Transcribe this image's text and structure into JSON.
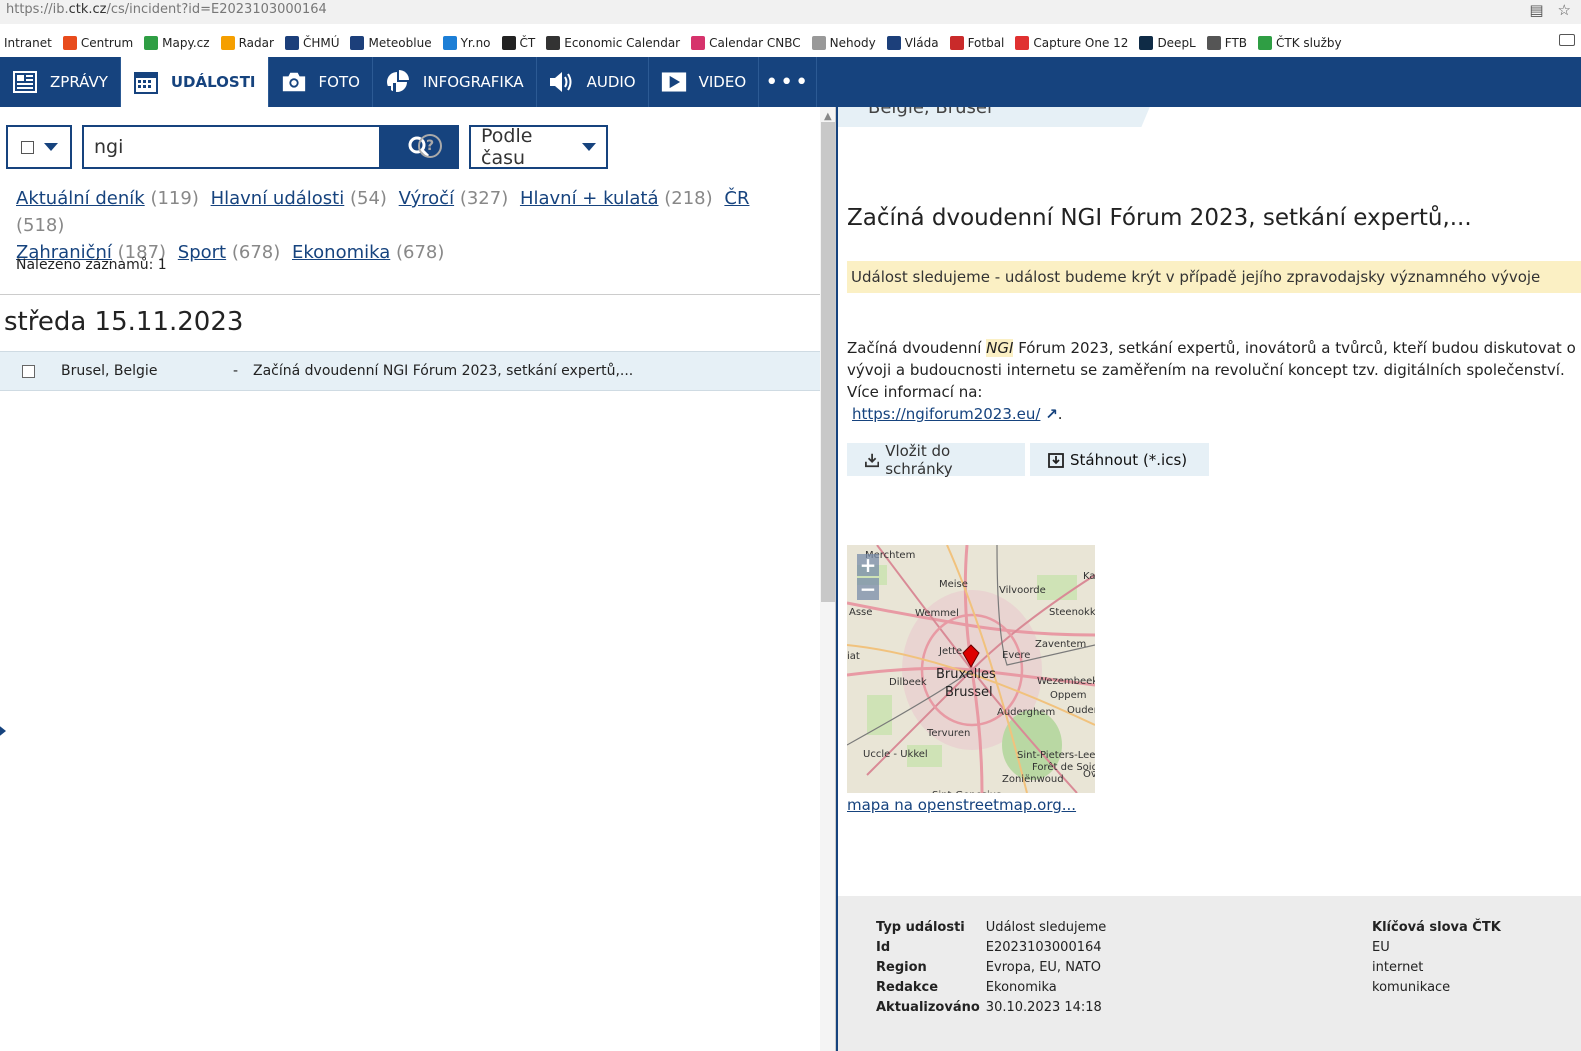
{
  "browser": {
    "url_prefix": "https://ib.",
    "url_domain": "ctk.cz",
    "url_rest": "/cs/incident?id=E2023103000164",
    "bookmarks": [
      {
        "label": "Intranet",
        "icon": "none",
        "color": ""
      },
      {
        "label": "Centrum",
        "icon": "centrum-icon",
        "color": "#e84b1c"
      },
      {
        "label": "Mapy.cz",
        "icon": "mapy-icon",
        "color": "#2f9e44"
      },
      {
        "label": "Radar",
        "icon": "sun-icon",
        "color": "#f59f00"
      },
      {
        "label": "ČHMÚ",
        "icon": "chmu-icon",
        "color": "#1c3f7a"
      },
      {
        "label": "Meteoblue",
        "icon": "meteoblue-icon",
        "color": "#1c3f7a"
      },
      {
        "label": "Yr.no",
        "icon": "yr-icon",
        "color": "#1c7ed6"
      },
      {
        "label": "ČT",
        "icon": "ct-icon",
        "color": "#222"
      },
      {
        "label": "Economic Calendar",
        "icon": "calendar-icon",
        "color": "#333"
      },
      {
        "label": "Calendar CNBC",
        "icon": "cnbc-icon",
        "color": "#d6336c"
      },
      {
        "label": "Nehody",
        "icon": "nehody-icon",
        "color": "#999"
      },
      {
        "label": "Vláda",
        "icon": "vlada-icon",
        "color": "#1c3f7a"
      },
      {
        "label": "Fotbal",
        "icon": "fotbal-icon",
        "color": "#c92a2a"
      },
      {
        "label": "Capture One 12",
        "icon": "youtube-icon",
        "color": "#e03131"
      },
      {
        "label": "DeepL",
        "icon": "deepl-icon",
        "color": "#0f2b46"
      },
      {
        "label": "FTB",
        "icon": "globe-icon",
        "color": "#555"
      },
      {
        "label": "ČTK služby",
        "icon": "drive-icon",
        "color": "#2f9e44"
      }
    ]
  },
  "nav": {
    "items": [
      {
        "label": "ZPRÁVY",
        "icon": "newspaper-icon"
      },
      {
        "label": "UDÁLOSTI",
        "icon": "calendar-icon"
      },
      {
        "label": "FOTO",
        "icon": "camera-icon"
      },
      {
        "label": "INFOGRAFIKA",
        "icon": "chart-icon"
      },
      {
        "label": "AUDIO",
        "icon": "speaker-icon"
      },
      {
        "label": "VIDEO",
        "icon": "video-icon"
      },
      {
        "label": "•••",
        "icon": "more-icon"
      }
    ],
    "active": "UDÁLOSTI"
  },
  "search": {
    "value": "ngi",
    "help": "?",
    "sort_label": "Podle času"
  },
  "filters": [
    {
      "label": "Aktuální deník",
      "count": "(119)"
    },
    {
      "label": "Hlavní události",
      "count": "(54)"
    },
    {
      "label": "Výročí",
      "count": "(327)"
    },
    {
      "label": "Hlavní + kulatá",
      "count": "(218)"
    },
    {
      "label": "ČR",
      "count": "(518)"
    },
    {
      "label": "Zahraniční",
      "count": "(187)"
    },
    {
      "label": "Sport",
      "count": "(678)"
    },
    {
      "label": "Ekonomika",
      "count": "(678)"
    }
  ],
  "results": {
    "found_text": "Nalezeno záznamů: 1",
    "day_label": "středa 15.11.2023",
    "rows": [
      {
        "place": "Brusel, Belgie",
        "dash": "-",
        "title": "Začíná dvoudenní NGI Fórum 2023, setkání expertů,..."
      }
    ]
  },
  "detail": {
    "location": "Belgie, Brusel",
    "title": "Začíná dvoudenní NGI Fórum 2023, setkání expertů,...",
    "notice": "Událost sledujeme - událost budeme krýt v případě jejího zpravodajsky významného vývoje",
    "desc_before": "Začíná dvoudenní ",
    "desc_highlight": "NGI",
    "desc_after": " Fórum 2023, setkání expertů, inovátorů a tvůrců, kteří budou diskutovat o vývoji a budoucnosti internetu se zaměřením na revoluční koncept tzv. digitálních společenství. Více informací na:",
    "link": "https://ngiforum2023.eu/",
    "link_suffix": ".",
    "button_clipboard": "Vložit do schránky",
    "button_ics": "Stáhnout (*.ics)",
    "map_link": "mapa na openstreetmap.org...",
    "map_labels": [
      "Merchtem",
      "Meise",
      "Vilvoorde",
      "Asse",
      "Wemmel",
      "Steenokkerzeel",
      "Jette",
      "Evere",
      "Zaventem",
      "Bruxelles",
      "Brussel",
      "Dilbeek",
      "Wezembeek",
      "Oppem",
      "Auderghem",
      "Oudergem",
      "Tervuren",
      "Uccle - Ukkel",
      "Sint-Pieters-Leeuw",
      "Forêt de Soignes",
      "Zoniënwoud",
      "Sint-Genesius",
      "Ka",
      "Ov",
      "iat"
    ],
    "meta": {
      "rows": [
        {
          "key": "Typ události",
          "value": "Událost sledujeme"
        },
        {
          "key": "Id",
          "value": "E2023103000164"
        },
        {
          "key": "Region",
          "value": "Evropa, EU, NATO"
        },
        {
          "key": "Redakce",
          "value": "Ekonomika"
        },
        {
          "key": "Aktualizováno",
          "value": "30.10.2023 14:18"
        }
      ],
      "keywords_header": "Klíčová slova ČTK",
      "keywords": [
        "EU",
        "internet",
        "komunikace"
      ]
    }
  },
  "colors": {
    "brand": "#16437e",
    "highlight": "#fbf0c4",
    "row_selected": "#e6f0f6"
  }
}
